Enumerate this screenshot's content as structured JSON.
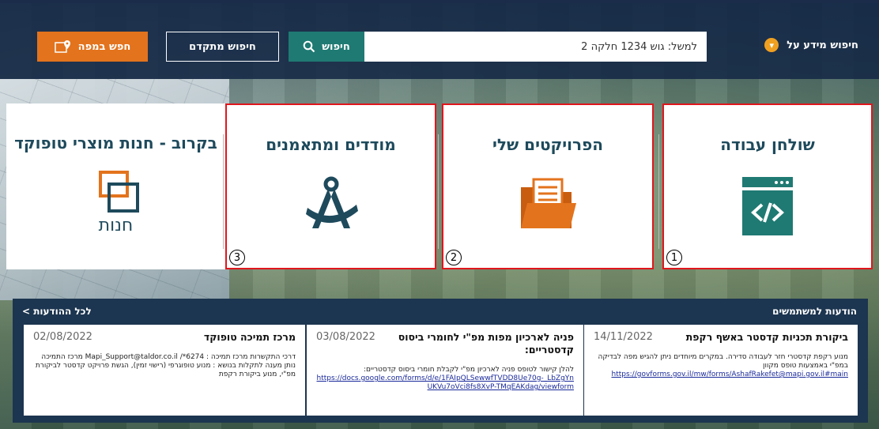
{
  "search": {
    "info_label": "חיפוש מידע על",
    "placeholder": "למשל: גוש 1234 חלקה 2",
    "search_label": "חיפוש",
    "advanced_label": "חיפוש מתקדם",
    "map_label": "חפש במפה"
  },
  "cards": [
    {
      "title": "שולחן עבודה",
      "number": "1",
      "icon": "code-window-icon"
    },
    {
      "title": "הפרויקטים שלי",
      "number": "2",
      "icon": "folder-documents-icon"
    },
    {
      "title": "מודדים ומתאמנים",
      "number": "3",
      "icon": "compass-icon"
    },
    {
      "title": "בקרוב - חנות מוצרי טופוקד",
      "store_label": "חנות",
      "icon": "store-logo-icon"
    }
  ],
  "notices": {
    "title": "הודעות למשתמשים",
    "all_label": "לכל ההודעות >",
    "items": [
      {
        "title": "ביקורת תכניות קדסטר באשף רקפת",
        "date": "14/11/2022",
        "body": "מנוע רקפת קדסטרי חזר לעבודה סדירה. במקרים מיוחדים ניתן להגיש מפה לבדיקה במפ\"י באמצעות טופס מקוון",
        "link": "https://govforms.gov.il/mw/forms/AshafRakefet@mapi.gov.il#main"
      },
      {
        "title": "פניה לארכיון מפות מפ\"י לחומרי ביסוס קדסטריים:",
        "date": "03/08/2022",
        "body": "להלן קישור לטופס פניה לארכיון מפ\"י לקבלת חומרי ביסוס קדסטריים:",
        "link": "https://docs.google.com/forms/d/e/1FAIpQLSewwfTVDD8Ue70g-_LbZgYnUKVu7oVci8fs8XvP-TMqEAKdag/viewform"
      },
      {
        "title": "מרכז תמיכה טופוקד",
        "date": "02/08/2022",
        "body": "דרכי התקשרות מרכז תמיכה : 6274*/ Mapi_Support@taldor.co.il מרכז התמיכה נותן מענה לתקלות בנושא : מנוע טופוגרפי (רישוי זמין), הגשת פרויקט קדסטר לביקורת מפ\"י, מנוע ביקורת רקפת",
        "link": ""
      }
    ]
  }
}
